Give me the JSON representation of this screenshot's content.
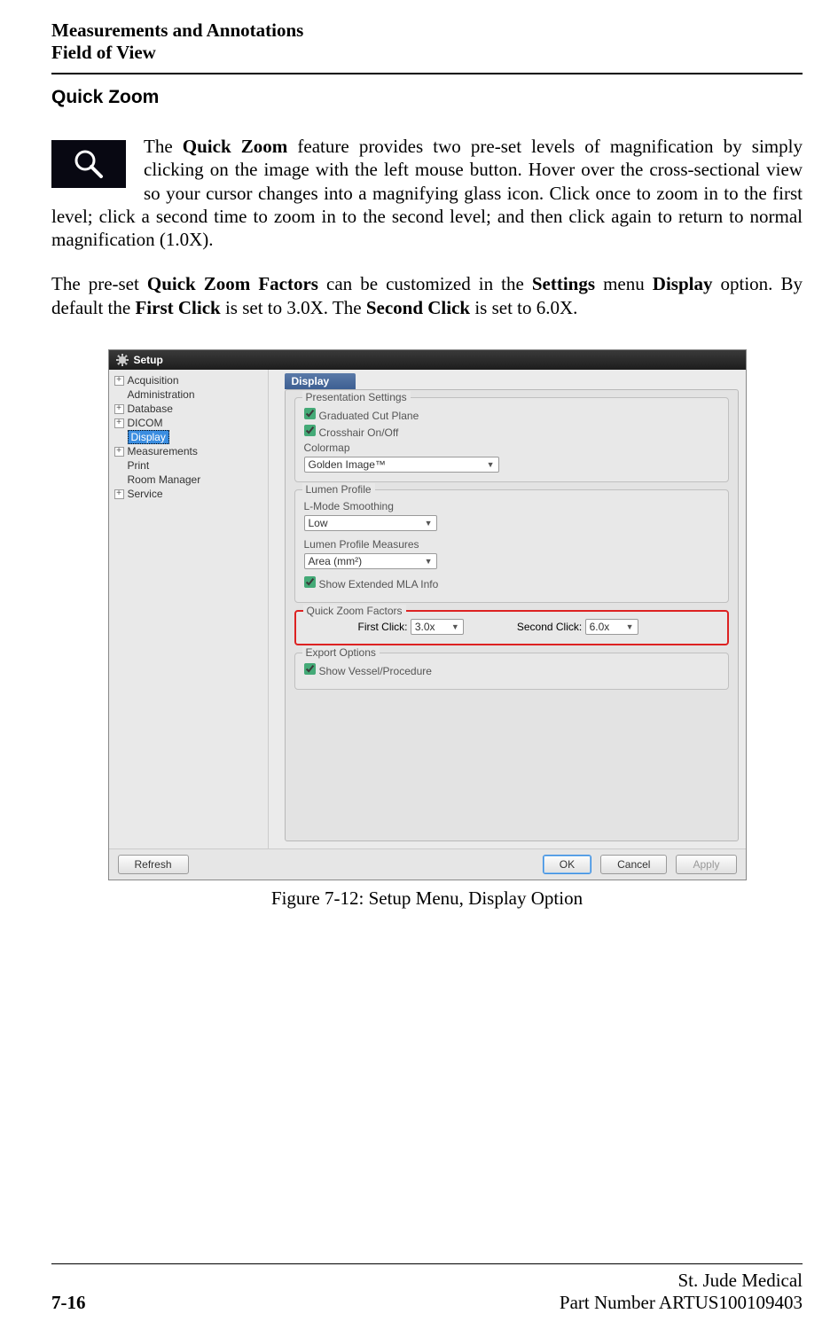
{
  "header": {
    "line1": "Measurements and Annotations",
    "line2": "Field of View"
  },
  "subhead": "Quick Zoom",
  "para1_pre": "The ",
  "para1_bold1": "Quick Zoom",
  "para1_rest": " feature provides two pre-set levels of magnification by simply clicking on the image with the left mouse button. Hover over the cross-sectional view so your cursor changes into a magnifying glass icon. Click once to zoom in to the first level; click a second time to zoom in to the second level; and then click again to return to normal magnification (1.0X).",
  "para2": {
    "t1": "The pre-set ",
    "b1": "Quick Zoom Factors",
    "t2": " can be customized in the ",
    "b2": "Settings",
    "t3": " menu ",
    "b3": "Display",
    "t4": " option. By default the ",
    "b4": "First Click",
    "t5": " is set to 3.0X. The ",
    "b5": "Second Click",
    "t6": " is set to 6.0X."
  },
  "setup": {
    "title": "Setup",
    "tree": [
      {
        "label": "Acquisition",
        "exp": "+"
      },
      {
        "label": "Administration",
        "exp": ""
      },
      {
        "label": "Database",
        "exp": "+"
      },
      {
        "label": "DICOM",
        "exp": "+"
      },
      {
        "label": "Display",
        "exp": "",
        "selected": true
      },
      {
        "label": "Measurements",
        "exp": "+"
      },
      {
        "label": "Print",
        "exp": ""
      },
      {
        "label": "Room Manager",
        "exp": ""
      },
      {
        "label": "Service",
        "exp": "+"
      }
    ],
    "panel_title": "Display",
    "presentation": {
      "group_label": "Presentation Settings",
      "cb1": "Graduated Cut Plane",
      "cb2": "Crosshair On/Off",
      "colormap_label": "Colormap",
      "colormap_value": "Golden Image™"
    },
    "lumen": {
      "group_label": "Lumen Profile",
      "smooth_label": "L-Mode Smoothing",
      "smooth_value": "Low",
      "measures_label": "Lumen Profile Measures",
      "measures_value": "Area (mm²)",
      "cb_ext": "Show Extended MLA Info"
    },
    "zoom": {
      "group_label": "Quick Zoom Factors",
      "first_label": "First Click:",
      "first_value": "3.0x",
      "second_label": "Second Click:",
      "second_value": "6.0x"
    },
    "export": {
      "group_label": "Export Options",
      "cb1": "Show Vessel/Procedure"
    },
    "buttons": {
      "refresh": "Refresh",
      "ok": "OK",
      "cancel": "Cancel",
      "apply": "Apply"
    }
  },
  "figure_caption": "Figure 7-12:  Setup Menu, Display Option",
  "footer": {
    "page": "7-16",
    "company": "St. Jude Medical",
    "part": "Part Number ARTUS100109403"
  }
}
